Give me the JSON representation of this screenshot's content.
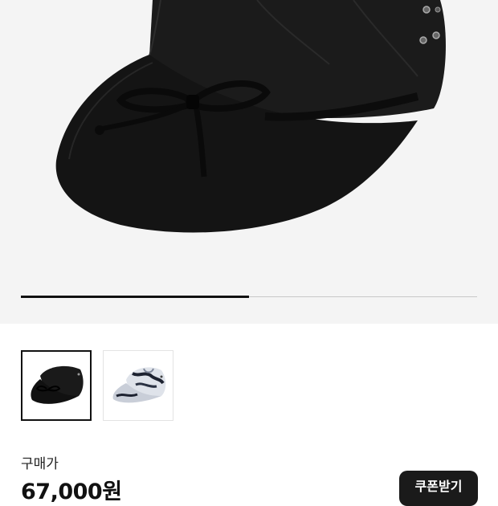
{
  "product": {
    "main_image": "black-cap-with-bow-tie",
    "carousel": {
      "current": 1,
      "total": 2,
      "progress": 0.5
    },
    "thumbnails": [
      {
        "image": "black-cap-thumbnail",
        "selected": true
      },
      {
        "image": "tie-dye-cap-thumbnail",
        "selected": false
      }
    ]
  },
  "price": {
    "label": "구매가",
    "value": "67,000원"
  },
  "coupon_button": {
    "label": "쿠폰받기"
  }
}
